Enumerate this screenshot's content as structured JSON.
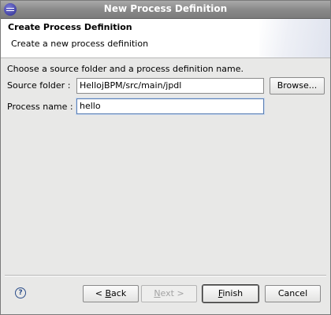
{
  "window": {
    "title": "New Process Definition"
  },
  "header": {
    "title": "Create Process Definition",
    "description": "Create a new process definition"
  },
  "form": {
    "instructions": "Choose a source folder and a process definition name.",
    "source_folder_label": "Source folder :",
    "source_folder_value": "HellojBPM/src/main/jpdl",
    "browse_label": "Browse...",
    "process_name_label": "Process name :",
    "process_name_value": "hello"
  },
  "buttons": {
    "help_symbol": "?",
    "back_prefix": "< ",
    "back_mnemonic": "B",
    "back_rest": "ack",
    "next_mnemonic": "N",
    "next_rest": "ext >",
    "finish_mnemonic": "F",
    "finish_rest": "inish",
    "cancel_label": "Cancel"
  },
  "icons": {
    "app": "eclipse-icon",
    "help": "help-icon"
  }
}
